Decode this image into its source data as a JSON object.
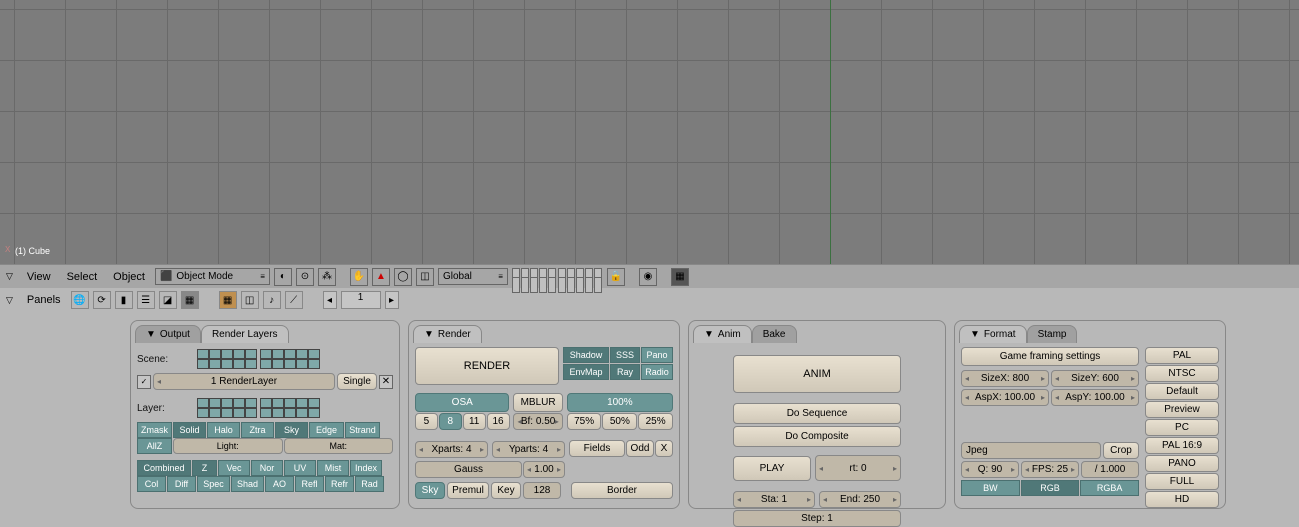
{
  "viewport": {
    "axis_label": "X",
    "object_label": "(1) Cube"
  },
  "header3d": {
    "view": "View",
    "select": "Select",
    "object": "Object",
    "mode": "Object Mode",
    "orientation": "Global"
  },
  "panels_bar": {
    "label": "Panels",
    "frame": "1"
  },
  "output_panel": {
    "tab_output": "Output",
    "tab_render_layers": "Render Layers",
    "scene_label": "Scene:",
    "render_layer": "1 RenderLayer",
    "single": "Single",
    "layer_label": "Layer:",
    "zmask": "Zmask",
    "solid": "Solid",
    "halo": "Halo",
    "ztra": "Ztra",
    "sky": "Sky",
    "edge": "Edge",
    "strand": "Strand",
    "allz": "AllZ",
    "light": "Light:",
    "mat": "Mat:",
    "combined": "Combined",
    "z": "Z",
    "vec": "Vec",
    "nor": "Nor",
    "uv": "UV",
    "mist": "Mist",
    "index": "Index",
    "col": "Col",
    "diff": "Diff",
    "spec": "Spec",
    "shad": "Shad",
    "ao": "AO",
    "refl": "Refl",
    "refr": "Refr",
    "rad": "Rad"
  },
  "render_panel": {
    "tab": "Render",
    "render_btn": "RENDER",
    "shadow": "Shadow",
    "sss": "SSS",
    "pano": "Pano",
    "envmap": "EnvMap",
    "ray": "Ray",
    "radio": "Radio",
    "osa": "OSA",
    "mblur": "MBLUR",
    "s5": "5",
    "s8": "8",
    "s11": "11",
    "s16": "16",
    "bf": "Bf: 0.50",
    "p100": "100%",
    "p75": "75%",
    "p50": "50%",
    "p25": "25%",
    "xparts": "Xparts: 4",
    "yparts": "Yparts: 4",
    "fields": "Fields",
    "odd": "Odd",
    "x": "X",
    "gauss": "Gauss",
    "g_val": "1.00",
    "sky": "Sky",
    "premul": "Premul",
    "key": "Key",
    "dither": "128",
    "border": "Border"
  },
  "anim_panel": {
    "tab_anim": "Anim",
    "tab_bake": "Bake",
    "anim_btn": "ANIM",
    "do_sequence": "Do Sequence",
    "do_composite": "Do Composite",
    "play": "PLAY",
    "rt": "rt: 0",
    "sta": "Sta: 1",
    "end": "End: 250",
    "step": "Step: 1"
  },
  "format_panel": {
    "tab_format": "Format",
    "tab_stamp": "Stamp",
    "game_framing": "Game framing settings",
    "sizex": "SizeX: 800",
    "sizey": "SizeY: 600",
    "aspx": "AspX: 100.00",
    "aspy": "AspY: 100.00",
    "jpeg": "Jpeg",
    "crop": "Crop",
    "q": "Q: 90",
    "fps": "FPS: 25",
    "fps_base": "/ 1.000",
    "bw": "BW",
    "rgb": "RGB",
    "rgba": "RGBA",
    "pal": "PAL",
    "ntsc": "NTSC",
    "default": "Default",
    "preview": "Preview",
    "pc": "PC",
    "pal169": "PAL 16:9",
    "pano": "PANO",
    "full": "FULL",
    "hd": "HD"
  }
}
